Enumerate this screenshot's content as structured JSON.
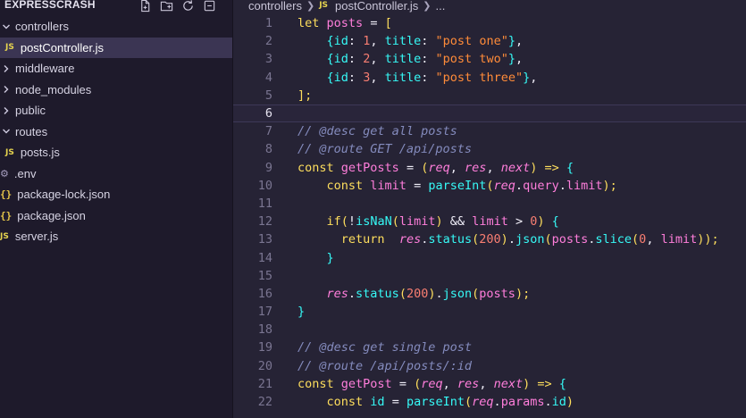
{
  "sidebar": {
    "title": "EXPRESSCRASH",
    "actions": [
      "new-file-icon",
      "new-folder-icon",
      "refresh-icon",
      "collapse-icon"
    ],
    "items": [
      {
        "label": "controllers",
        "type": "folder-open",
        "indent": 0
      },
      {
        "label": "postController.js",
        "type": "js",
        "indent": 1,
        "active": true
      },
      {
        "label": "middleware",
        "type": "folder",
        "indent": 0
      },
      {
        "label": "node_modules",
        "type": "folder",
        "indent": 0
      },
      {
        "label": "public",
        "type": "folder",
        "indent": 0
      },
      {
        "label": "routes",
        "type": "folder-open",
        "indent": 0
      },
      {
        "label": "posts.js",
        "type": "js",
        "indent": 1
      },
      {
        "label": ".env",
        "type": "gear",
        "indent": 0
      },
      {
        "label": "package-lock.json",
        "type": "json",
        "indent": 0
      },
      {
        "label": "package.json",
        "type": "json",
        "indent": 0
      },
      {
        "label": "server.js",
        "type": "js",
        "indent": 0
      }
    ]
  },
  "breadcrumb": {
    "folder": "controllers",
    "file_badge": "JS",
    "file": "postController.js",
    "more": "..."
  },
  "editor": {
    "current_line": 6,
    "lines": [
      {
        "n": "1",
        "code": "let posts = ["
      },
      {
        "n": "2",
        "code": "    {id: 1, title: \"post one\"},"
      },
      {
        "n": "3",
        "code": "    {id: 2, title: \"post two\"},"
      },
      {
        "n": "4",
        "code": "    {id: 3, title: \"post three\"},"
      },
      {
        "n": "5",
        "code": "];"
      },
      {
        "n": "6",
        "code": ""
      },
      {
        "n": "7",
        "code": "// @desc get all posts"
      },
      {
        "n": "8",
        "code": "// @route GET /api/posts"
      },
      {
        "n": "9",
        "code": "const getPosts = (req, res, next) => {"
      },
      {
        "n": "10",
        "code": "    const limit = parseInt(req.query.limit);"
      },
      {
        "n": "11",
        "code": ""
      },
      {
        "n": "12",
        "code": "    if(!isNaN(limit) && limit > 0) {"
      },
      {
        "n": "13",
        "code": "      return  res.status(200).json(posts.slice(0, limit));"
      },
      {
        "n": "14",
        "code": "    }"
      },
      {
        "n": "15",
        "code": ""
      },
      {
        "n": "16",
        "code": "    res.status(200).json(posts);"
      },
      {
        "n": "17",
        "code": "}"
      },
      {
        "n": "18",
        "code": ""
      },
      {
        "n": "19",
        "code": "// @desc get single post"
      },
      {
        "n": "20",
        "code": "// @route /api/posts/:id"
      },
      {
        "n": "21",
        "code": "const getPost = (req, res, next) => {"
      },
      {
        "n": "22",
        "code": "    const id = parseInt(req.params.id)"
      }
    ]
  }
}
